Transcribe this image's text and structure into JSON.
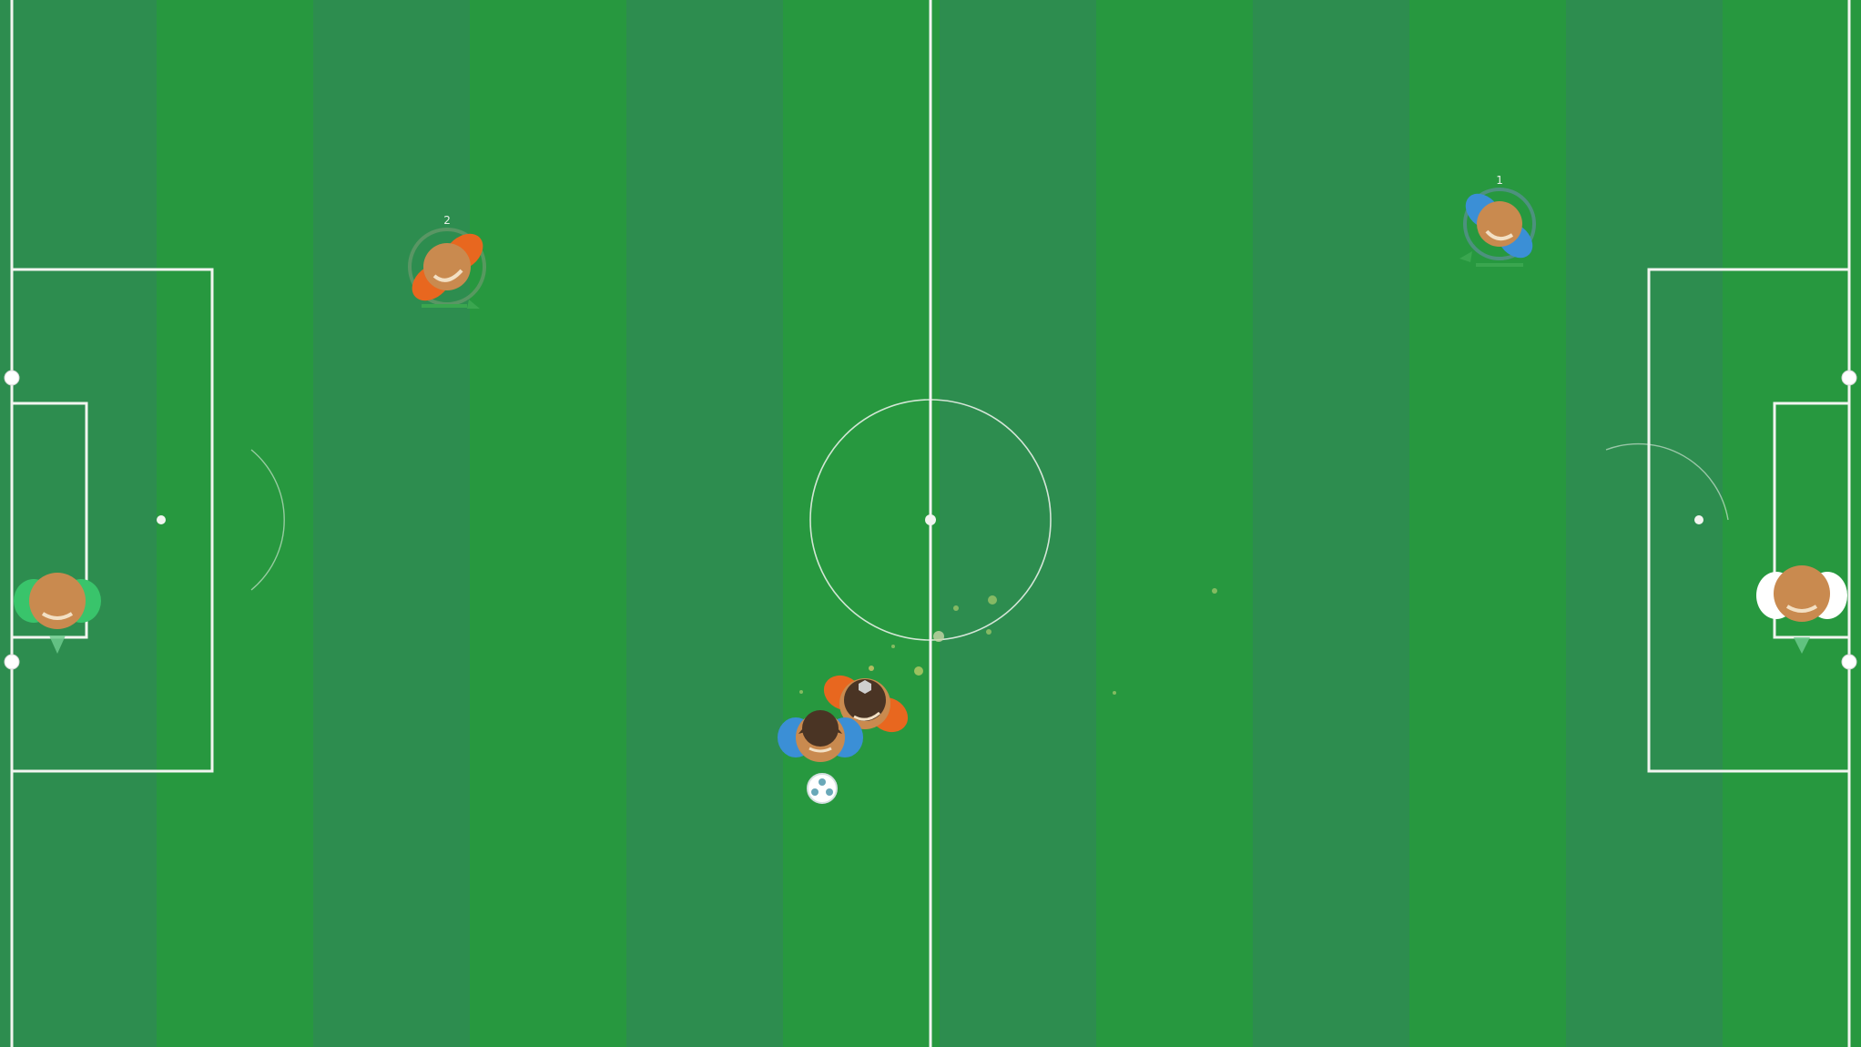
{
  "game": {
    "type": "top-down soccer",
    "colors": {
      "stripe_dark": "#2d8d4f",
      "stripe_light": "#27983f",
      "lines": "#f2f5f0",
      "team_orange": "#e8671f",
      "team_blue": "#3b8fd6",
      "keeper_green": "#39c46b",
      "keeper_white": "#ffffff",
      "skin": "#c98a4f",
      "hair_dark": "#4a3424"
    }
  },
  "players": [
    {
      "id": "orange-2",
      "team": "orange",
      "number_label": "2",
      "has_hair": false
    },
    {
      "id": "blue-1",
      "team": "blue",
      "number_label": "1",
      "has_hair": false
    },
    {
      "id": "orange-mid",
      "team": "orange",
      "number_label": "",
      "has_hair": true
    },
    {
      "id": "blue-mid",
      "team": "blue",
      "number_label": "",
      "has_hair": true
    },
    {
      "id": "keeper-left",
      "team": "green",
      "number_label": "",
      "has_hair": false
    },
    {
      "id": "keeper-right",
      "team": "white",
      "number_label": "",
      "has_hair": false
    }
  ],
  "ball": {
    "icon": "soccer-ball-icon"
  }
}
